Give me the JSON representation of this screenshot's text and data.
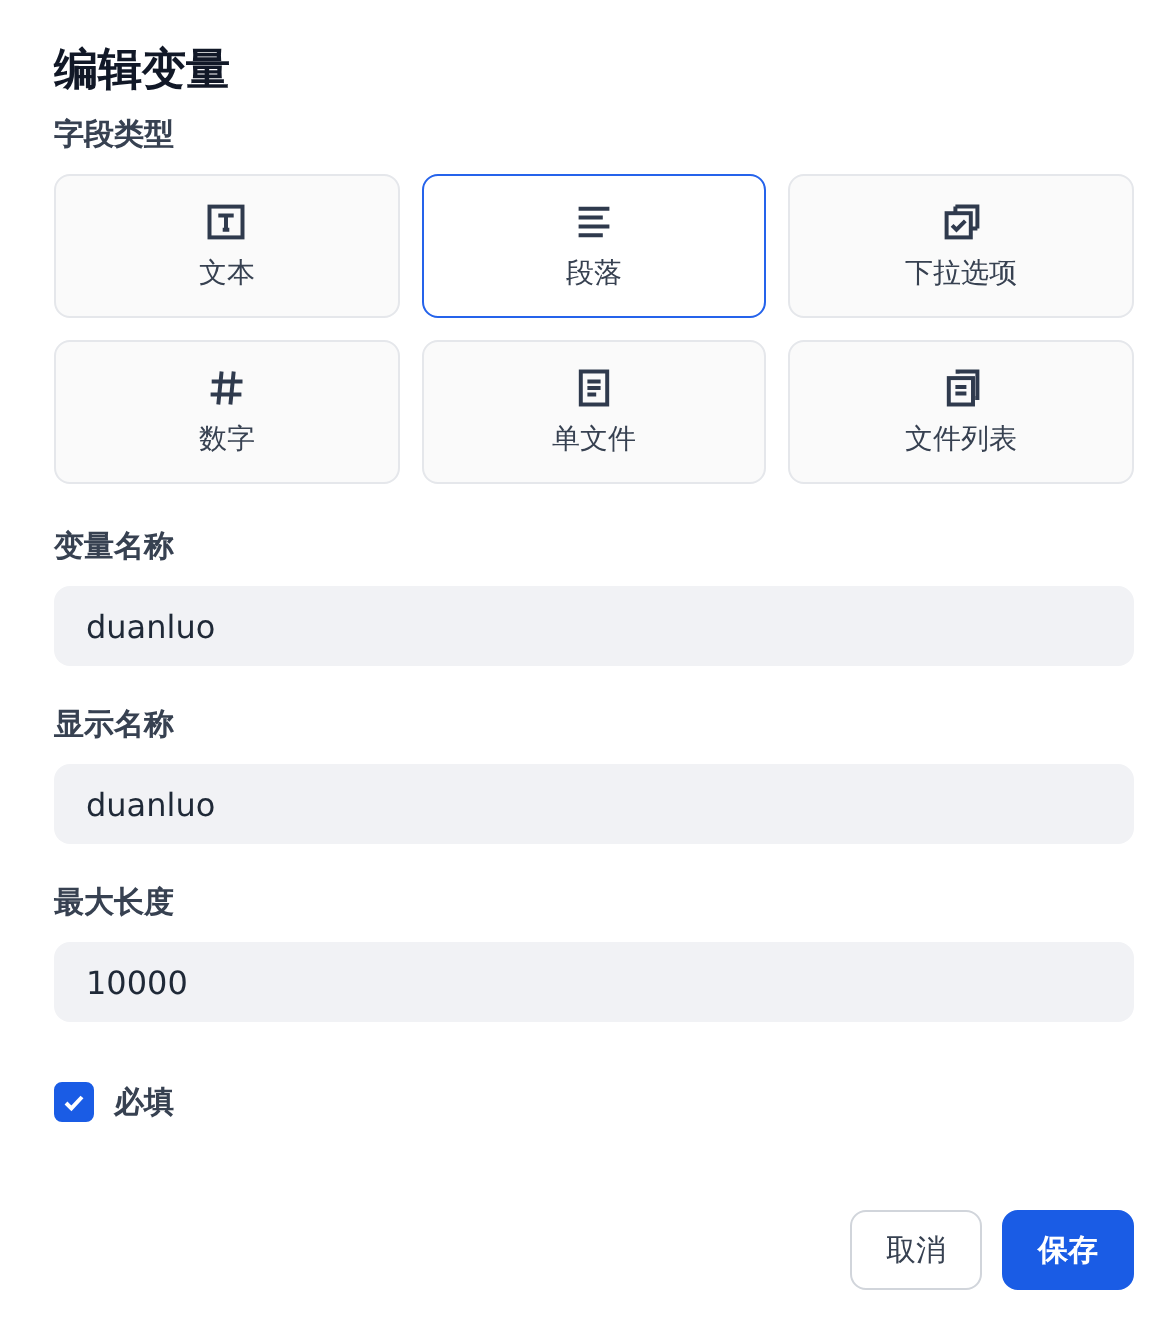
{
  "title": "编辑变量",
  "field_type": {
    "label": "字段类型",
    "options": [
      {
        "kind": "text",
        "label": "文本",
        "selected": false
      },
      {
        "kind": "paragraph",
        "label": "段落",
        "selected": true
      },
      {
        "kind": "select",
        "label": "下拉选项",
        "selected": false
      },
      {
        "kind": "number",
        "label": "数字",
        "selected": false
      },
      {
        "kind": "file",
        "label": "单文件",
        "selected": false
      },
      {
        "kind": "file_list",
        "label": "文件列表",
        "selected": false
      }
    ]
  },
  "fields": [
    {
      "label": "变量名称",
      "value": "duanluo"
    },
    {
      "label": "显示名称",
      "value": "duanluo"
    },
    {
      "label": "最大长度",
      "value": "10000"
    }
  ],
  "required": {
    "label": "必填",
    "checked": true
  },
  "buttons": [
    {
      "kind": "secondary",
      "label": "取消"
    },
    {
      "kind": "primary",
      "label": "保存"
    }
  ]
}
